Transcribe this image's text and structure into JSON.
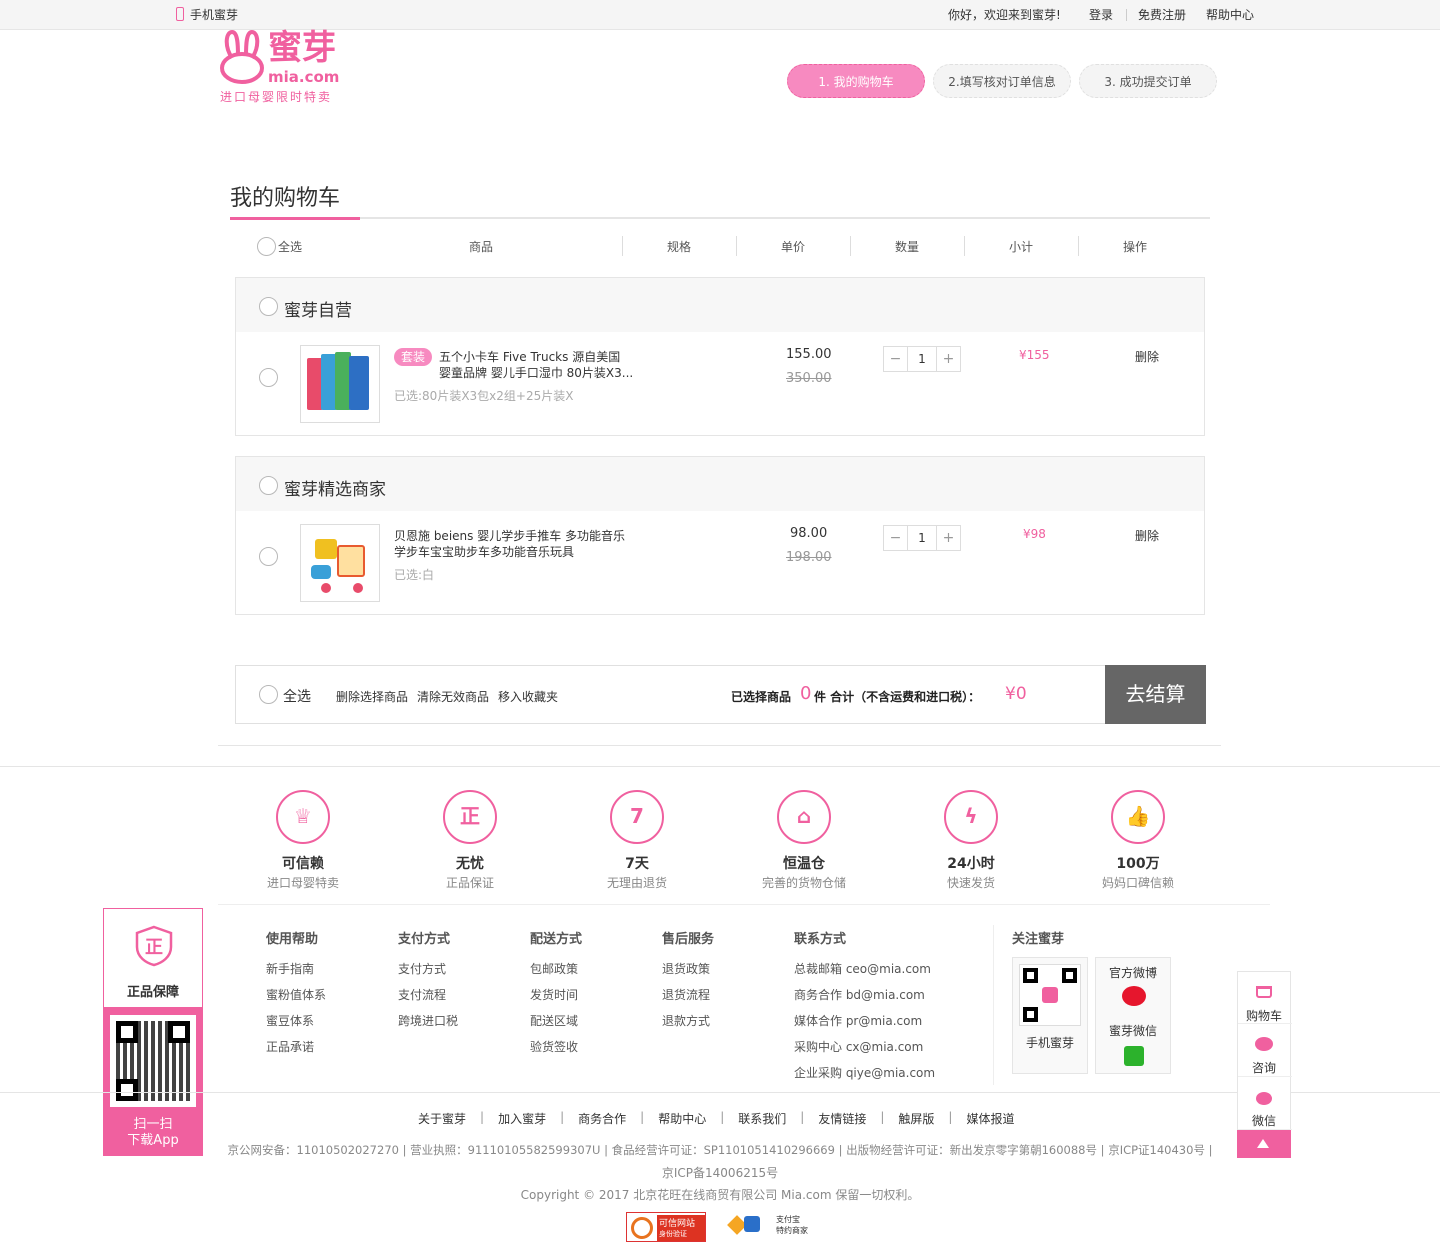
{
  "topbar": {
    "mobile_label": "手机蜜芽",
    "welcome": "你好，欢迎来到蜜芽!",
    "login": "登录",
    "register": "免费注册",
    "help": "帮助中心"
  },
  "logo": {
    "text_cn": "蜜芽",
    "text_en": "mia.com",
    "slogan": "进口母婴限时特卖"
  },
  "steps": [
    "1. 我的购物车",
    "2.填写核对订单信息",
    "3. 成功提交订单"
  ],
  "page_title": "我的购物车",
  "columns": {
    "select_all": "全选",
    "product": "商品",
    "spec": "规格",
    "price": "单价",
    "qty": "数量",
    "subtotal": "小计",
    "action": "操作"
  },
  "shops": [
    {
      "name": "蜜芽自营",
      "item": {
        "tag": "套装",
        "title_line1": "五个小卡车 Five Trucks 源自美国",
        "title_line2": "婴童品牌 婴儿手口湿巾 80片装X3...",
        "selected": "已选:80片装X3包x2组+25片装X",
        "price": "155.00",
        "original_price": "350.00",
        "qty": "1",
        "subtotal": "¥155",
        "delete": "删除"
      }
    },
    {
      "name": "蜜芽精选商家",
      "item": {
        "title_line1": "贝恩施 beiens 婴儿学步手推车 多功能音乐",
        "title_line2": "学步车宝宝助步车多功能音乐玩具",
        "selected": "已选:白",
        "price": "98.00",
        "original_price": "198.00",
        "qty": "1",
        "subtotal": "¥98",
        "delete": "删除"
      }
    }
  ],
  "bottom_bar": {
    "select_all": "全选",
    "delete_selected": "删除选择商品",
    "clear_invalid": "清除无效商品",
    "move_favorites": "移入收藏夹",
    "selected_prefix": "已选择商品",
    "selected_count": "0",
    "selected_suffix": "件 合计（不含运费和进口税）：",
    "total": "¥0",
    "checkout": "去结算"
  },
  "features": [
    {
      "icon": "crown-icon",
      "title": "可信赖",
      "sub": "进口母婴特卖"
    },
    {
      "icon": "genuine-icon",
      "title": "无忧",
      "sub": "正品保证"
    },
    {
      "icon": "seven-icon",
      "title": "7天",
      "sub": "无理由退货"
    },
    {
      "icon": "warehouse-icon",
      "title": "恒温仓",
      "sub": "完善的货物仓储"
    },
    {
      "icon": "lightning-icon",
      "title": "24小时",
      "sub": "快速发货"
    },
    {
      "icon": "thumbs-up-icon",
      "title": "100万",
      "sub": "妈妈口碑信赖"
    }
  ],
  "guarantee_badge": {
    "title": "正品保障",
    "scan1": "扫一扫",
    "scan2": "下载App"
  },
  "help_columns": [
    {
      "title": "使用帮助",
      "items": [
        "新手指南",
        "蜜粉值体系",
        "蜜豆体系",
        "正品承诺"
      ]
    },
    {
      "title": "支付方式",
      "items": [
        "支付方式",
        "支付流程",
        "跨境进口税"
      ]
    },
    {
      "title": "配送方式",
      "items": [
        "包邮政策",
        "发货时间",
        "配送区域",
        "验货签收"
      ]
    },
    {
      "title": "售后服务",
      "items": [
        "退货政策",
        "退货流程",
        "退款方式"
      ]
    },
    {
      "title": "联系方式",
      "items": [
        "总裁邮箱 ceo@mia.com",
        "商务合作 bd@mia.com",
        "媒体合作 pr@mia.com",
        "采购中心 cx@mia.com",
        "企业采购 qiye@mia.com"
      ]
    }
  ],
  "follow": {
    "title": "关注蜜芽",
    "mobile": "手机蜜芽",
    "weibo": "官方微博",
    "wechat": "蜜芽微信"
  },
  "footer_links": [
    "关于蜜芽",
    "加入蜜芽",
    "商务合作",
    "帮助中心",
    "联系我们",
    "友情链接",
    "触屏版",
    "媒体报道"
  ],
  "license_line1": "京公网安备：11010502027270 | 营业执照：91110105582599307U | 食品经营许可证：SP1101051410296669 | 出版物经营许可证：新出发京零字第朝160088号 | 京ICP证140430号 |",
  "license_line2": "京ICP备14006215号",
  "copyright": "Copyright © 2017 北京花旺在线商贸有限公司 Mia.com 保留一切权利。",
  "badges": {
    "trusted1": "可信网站",
    "trusted2": "身份验证",
    "alipay1": "支付宝",
    "alipay2": "特约商家"
  },
  "sidebar": {
    "cart": "购物车",
    "consult": "咨询",
    "wechat": "微信"
  },
  "colors": {
    "brand_pink": "#f0609f",
    "checkout_gray": "#666666"
  }
}
